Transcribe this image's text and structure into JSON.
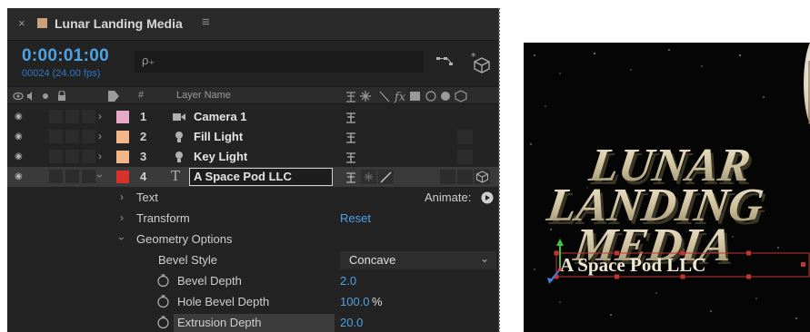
{
  "panel": {
    "comp_name": "Lunar Landing Media",
    "close_glyph": "×",
    "menu_glyph": "≡",
    "timecode": "0:00:01:00",
    "frames": "00024 (24.00 fps)",
    "search_placeholder": "",
    "search_glyph": "ρ₊"
  },
  "header": {
    "number_col": "#",
    "layer_name_col": "Layer Name"
  },
  "layers": [
    {
      "number": "1",
      "name": "Camera 1",
      "label_color": "#e7a9c8",
      "expanded": false
    },
    {
      "number": "2",
      "name": "Fill Light",
      "label_color": "#f3b688",
      "expanded": false
    },
    {
      "number": "3",
      "name": "Key  Light",
      "label_color": "#f3b688",
      "expanded": false
    },
    {
      "number": "4",
      "name": "A Space Pod LLC",
      "label_color": "#d8322a",
      "expanded": true
    }
  ],
  "properties": {
    "text": "Text",
    "animate": "Animate:",
    "transform": "Transform",
    "reset": "Reset",
    "geometry": "Geometry Options",
    "bevel_style": "Bevel Style",
    "bevel_style_value": "Concave",
    "bevel_depth": "Bevel Depth",
    "bevel_depth_value": "2.0",
    "hole_bevel_depth": "Hole Bevel Depth",
    "hole_bevel_depth_value": "100.0",
    "hole_bevel_unit": "%",
    "extrusion_depth": "Extrusion Depth",
    "extrusion_depth_value": "20.0"
  },
  "viewer": {
    "title_lines": [
      "LUNAR",
      "LANDING",
      "MEDIA"
    ],
    "selected_text": "A Space Pod LLC"
  },
  "colors": {
    "accent_blue": "#4ea2e6",
    "panel_bg": "#232323",
    "selection_red": "#d8322a"
  },
  "icons": {
    "eye": "eye-icon",
    "camera": "camera-layer-icon",
    "light": "light-layer-icon",
    "text": "text-layer-icon",
    "stopwatch": "stopwatch-icon"
  }
}
